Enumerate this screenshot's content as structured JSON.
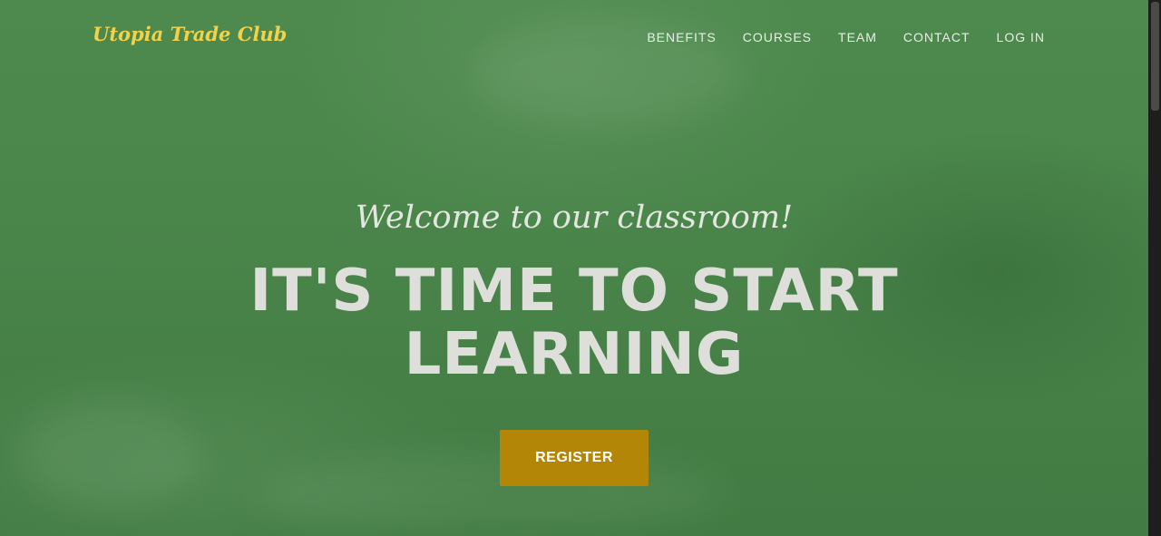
{
  "brand": {
    "name": "Utopia Trade Club",
    "color": "#f2d24a"
  },
  "nav": {
    "items": [
      {
        "label": "BENEFITS"
      },
      {
        "label": "COURSES"
      },
      {
        "label": "TEAM"
      },
      {
        "label": "CONTACT"
      },
      {
        "label": "LOG IN"
      }
    ]
  },
  "hero": {
    "welcome": "Welcome to our classroom!",
    "headline_line1": "IT'S TIME TO START",
    "headline_line2": "LEARNING",
    "background_color": "#4a854a"
  },
  "cta": {
    "register_label": "REGISTER",
    "color": "#b48608"
  }
}
